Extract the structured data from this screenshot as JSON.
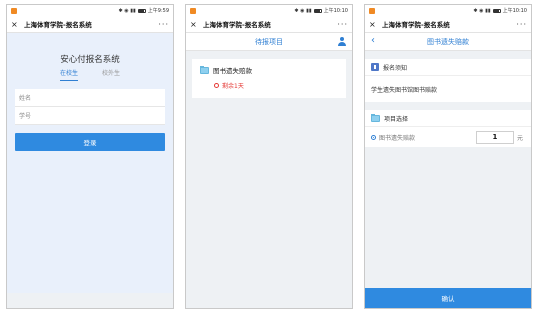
{
  "status_bar": {
    "screen1_right": "上午9:59",
    "screen2_right": "上午10:10",
    "screen3_right": "上午10:10"
  },
  "app": {
    "title": "上海体育学院-报名系统",
    "more": "···",
    "close": "×"
  },
  "login": {
    "heading": "安心付报名系统",
    "tabs": [
      "在校生",
      "校外生"
    ],
    "name_placeholder": "姓名",
    "id_placeholder": "学号",
    "login_button": "登录"
  },
  "pending": {
    "header": "待报项目",
    "card_title": "图书遗失赔款",
    "remaining": "剩余1天"
  },
  "detail": {
    "header": "图书遗失赔款",
    "notice_head": "报名须知",
    "notice_body": "学生遗失图书馆图书赔款",
    "select_head": "项目选择",
    "item_label": "图书遗失赔款",
    "quantity": "1",
    "unit": "元",
    "confirm_button": "确认"
  },
  "colors": {
    "accent": "#2f8ae0",
    "link": "#2f7fd3",
    "warning": "#e53935"
  }
}
